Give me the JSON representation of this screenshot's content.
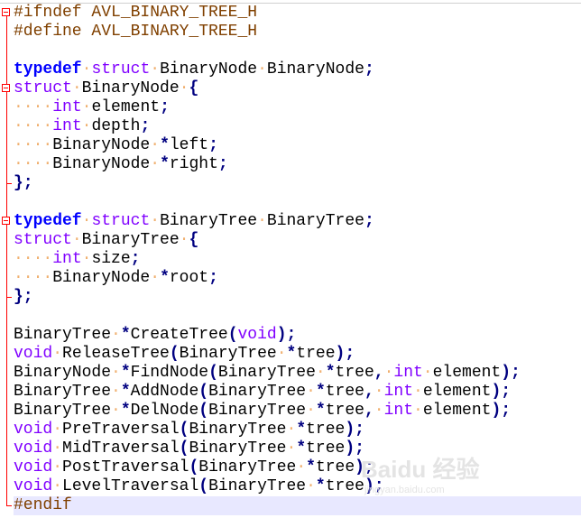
{
  "editor": {
    "current_line": 27,
    "colors": {
      "preprocessor": "#804000",
      "keyword": "#0000ff",
      "type": "#8000ff",
      "operator": "#000080",
      "whitespace": "#f0b070",
      "fold_marker": "#ff0000",
      "current_line": "#e8e8ff"
    },
    "fold_starts": [
      1,
      5,
      12
    ],
    "fold_ends": [
      10,
      16,
      27
    ],
    "lines": [
      [
        [
          "pp",
          "#ifndef AVL_BINARY_TREE_H"
        ]
      ],
      [
        [
          "pp",
          "#define AVL_BINARY_TREE_H"
        ]
      ],
      [],
      [
        [
          "kw",
          "typedef"
        ],
        [
          "ws",
          " "
        ],
        [
          "ty",
          "struct"
        ],
        [
          "ws",
          " "
        ],
        [
          "id",
          "BinaryNode"
        ],
        [
          "ws",
          " "
        ],
        [
          "id",
          "BinaryNode"
        ],
        [
          "op",
          ";"
        ]
      ],
      [
        [
          "ty",
          "struct"
        ],
        [
          "ws",
          " "
        ],
        [
          "id",
          "BinaryNode"
        ],
        [
          "ws",
          " "
        ],
        [
          "op",
          "{"
        ]
      ],
      [
        [
          "ws",
          "    "
        ],
        [
          "ty",
          "int"
        ],
        [
          "ws",
          " "
        ],
        [
          "id",
          "element"
        ],
        [
          "op",
          ";"
        ]
      ],
      [
        [
          "ws",
          "    "
        ],
        [
          "ty",
          "int"
        ],
        [
          "ws",
          " "
        ],
        [
          "id",
          "depth"
        ],
        [
          "op",
          ";"
        ]
      ],
      [
        [
          "ws",
          "    "
        ],
        [
          "id",
          "BinaryNode"
        ],
        [
          "ws",
          " "
        ],
        [
          "op",
          "*"
        ],
        [
          "id",
          "left"
        ],
        [
          "op",
          ";"
        ]
      ],
      [
        [
          "ws",
          "    "
        ],
        [
          "id",
          "BinaryNode"
        ],
        [
          "ws",
          " "
        ],
        [
          "op",
          "*"
        ],
        [
          "id",
          "right"
        ],
        [
          "op",
          ";"
        ]
      ],
      [
        [
          "op",
          "};"
        ]
      ],
      [],
      [
        [
          "kw",
          "typedef"
        ],
        [
          "ws",
          " "
        ],
        [
          "ty",
          "struct"
        ],
        [
          "ws",
          " "
        ],
        [
          "id",
          "BinaryTree"
        ],
        [
          "ws",
          " "
        ],
        [
          "id",
          "BinaryTree"
        ],
        [
          "op",
          ";"
        ]
      ],
      [
        [
          "ty",
          "struct"
        ],
        [
          "ws",
          " "
        ],
        [
          "id",
          "BinaryTree"
        ],
        [
          "ws",
          " "
        ],
        [
          "op",
          "{"
        ]
      ],
      [
        [
          "ws",
          "    "
        ],
        [
          "ty",
          "int"
        ],
        [
          "ws",
          " "
        ],
        [
          "id",
          "size"
        ],
        [
          "op",
          ";"
        ]
      ],
      [
        [
          "ws",
          "    "
        ],
        [
          "id",
          "BinaryNode"
        ],
        [
          "ws",
          " "
        ],
        [
          "op",
          "*"
        ],
        [
          "id",
          "root"
        ],
        [
          "op",
          ";"
        ]
      ],
      [
        [
          "op",
          "};"
        ]
      ],
      [],
      [
        [
          "id",
          "BinaryTree"
        ],
        [
          "ws",
          " "
        ],
        [
          "op",
          "*"
        ],
        [
          "id",
          "CreateTree"
        ],
        [
          "op",
          "("
        ],
        [
          "ty",
          "void"
        ],
        [
          "op",
          ");"
        ]
      ],
      [
        [
          "ty",
          "void"
        ],
        [
          "ws",
          " "
        ],
        [
          "id",
          "ReleaseTree"
        ],
        [
          "op",
          "("
        ],
        [
          "id",
          "BinaryTree"
        ],
        [
          "ws",
          " "
        ],
        [
          "op",
          "*"
        ],
        [
          "id",
          "tree"
        ],
        [
          "op",
          ");"
        ]
      ],
      [
        [
          "id",
          "BinaryNode"
        ],
        [
          "ws",
          " "
        ],
        [
          "op",
          "*"
        ],
        [
          "id",
          "FindNode"
        ],
        [
          "op",
          "("
        ],
        [
          "id",
          "BinaryTree"
        ],
        [
          "ws",
          " "
        ],
        [
          "op",
          "*"
        ],
        [
          "id",
          "tree"
        ],
        [
          "op",
          ","
        ],
        [
          "ws",
          " "
        ],
        [
          "ty",
          "int"
        ],
        [
          "ws",
          " "
        ],
        [
          "id",
          "element"
        ],
        [
          "op",
          ");"
        ]
      ],
      [
        [
          "id",
          "BinaryTree"
        ],
        [
          "ws",
          " "
        ],
        [
          "op",
          "*"
        ],
        [
          "id",
          "AddNode"
        ],
        [
          "op",
          "("
        ],
        [
          "id",
          "BinaryTree"
        ],
        [
          "ws",
          " "
        ],
        [
          "op",
          "*"
        ],
        [
          "id",
          "tree"
        ],
        [
          "op",
          ","
        ],
        [
          "ws",
          " "
        ],
        [
          "ty",
          "int"
        ],
        [
          "ws",
          " "
        ],
        [
          "id",
          "element"
        ],
        [
          "op",
          ");"
        ]
      ],
      [
        [
          "id",
          "BinaryTree"
        ],
        [
          "ws",
          " "
        ],
        [
          "op",
          "*"
        ],
        [
          "id",
          "DelNode"
        ],
        [
          "op",
          "("
        ],
        [
          "id",
          "BinaryTree"
        ],
        [
          "ws",
          " "
        ],
        [
          "op",
          "*"
        ],
        [
          "id",
          "tree"
        ],
        [
          "op",
          ","
        ],
        [
          "ws",
          " "
        ],
        [
          "ty",
          "int"
        ],
        [
          "ws",
          " "
        ],
        [
          "id",
          "element"
        ],
        [
          "op",
          ");"
        ]
      ],
      [
        [
          "ty",
          "void"
        ],
        [
          "ws",
          " "
        ],
        [
          "id",
          "PreTraversal"
        ],
        [
          "op",
          "("
        ],
        [
          "id",
          "BinaryTree"
        ],
        [
          "ws",
          " "
        ],
        [
          "op",
          "*"
        ],
        [
          "id",
          "tree"
        ],
        [
          "op",
          ");"
        ]
      ],
      [
        [
          "ty",
          "void"
        ],
        [
          "ws",
          " "
        ],
        [
          "id",
          "MidTraversal"
        ],
        [
          "op",
          "("
        ],
        [
          "id",
          "BinaryTree"
        ],
        [
          "ws",
          " "
        ],
        [
          "op",
          "*"
        ],
        [
          "id",
          "tree"
        ],
        [
          "op",
          ");"
        ]
      ],
      [
        [
          "ty",
          "void"
        ],
        [
          "ws",
          " "
        ],
        [
          "id",
          "PostTraversal"
        ],
        [
          "op",
          "("
        ],
        [
          "id",
          "BinaryTree"
        ],
        [
          "ws",
          " "
        ],
        [
          "op",
          "*"
        ],
        [
          "id",
          "tree"
        ],
        [
          "op",
          ");"
        ]
      ],
      [
        [
          "ty",
          "void"
        ],
        [
          "ws",
          " "
        ],
        [
          "id",
          "LevelTraversal"
        ],
        [
          "op",
          "("
        ],
        [
          "id",
          "BinaryTree"
        ],
        [
          "ws",
          " "
        ],
        [
          "op",
          "*"
        ],
        [
          "id",
          "tree"
        ],
        [
          "op",
          ");"
        ]
      ],
      [
        [
          "pp",
          "#endif"
        ]
      ]
    ]
  },
  "watermark": {
    "main": "Baidu 经验",
    "sub": "jingyan.baidu.com"
  }
}
